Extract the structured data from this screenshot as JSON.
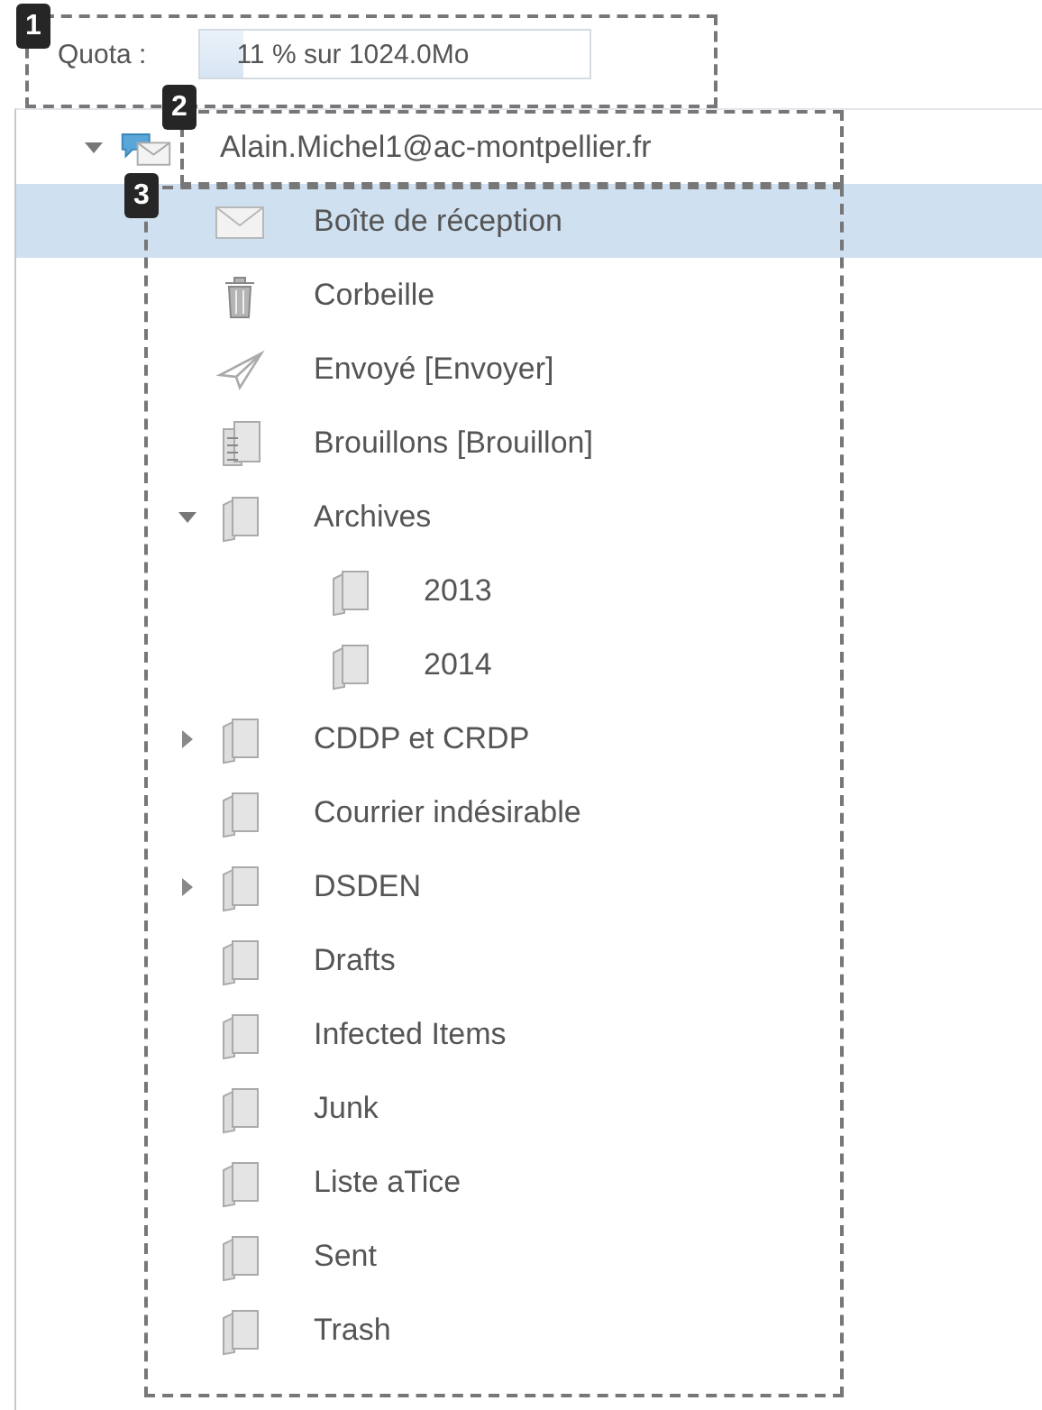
{
  "quota": {
    "label": "Quota :",
    "level": 0.11,
    "text": "11 % sur 1024.0Mo"
  },
  "account": {
    "address": "Alain.Michel1@ac-montpellier.fr",
    "expanded": true
  },
  "folders": [
    {
      "name": "Boîte de réception",
      "kind": "inbox",
      "selected": true
    },
    {
      "name": "Corbeille",
      "kind": "trash",
      "selected": false
    },
    {
      "name": "Envoyé [Envoyer]",
      "kind": "sent",
      "selected": false
    },
    {
      "name": "Brouillons [Brouillon]",
      "kind": "drafts",
      "selected": false
    },
    {
      "name": "Archives",
      "kind": "folder",
      "selected": false,
      "expanded": true,
      "children": [
        {
          "name": "2013",
          "kind": "folder",
          "selected": false
        },
        {
          "name": "2014",
          "kind": "folder",
          "selected": false
        }
      ]
    },
    {
      "name": "CDDP et CRDP",
      "kind": "folder",
      "selected": false,
      "expanded": false
    },
    {
      "name": "Courrier indésirable",
      "kind": "folder",
      "selected": false
    },
    {
      "name": "DSDEN",
      "kind": "folder",
      "selected": false,
      "expanded": false
    },
    {
      "name": "Drafts",
      "kind": "folder",
      "selected": false
    },
    {
      "name": "Infected Items",
      "kind": "folder",
      "selected": false
    },
    {
      "name": "Junk",
      "kind": "folder",
      "selected": false
    },
    {
      "name": "Liste aTice",
      "kind": "folder",
      "selected": false
    },
    {
      "name": "Sent",
      "kind": "folder",
      "selected": false
    },
    {
      "name": "Trash",
      "kind": "folder",
      "selected": false
    }
  ],
  "annotations": [
    {
      "number": "1"
    },
    {
      "number": "2"
    },
    {
      "number": "3"
    }
  ]
}
